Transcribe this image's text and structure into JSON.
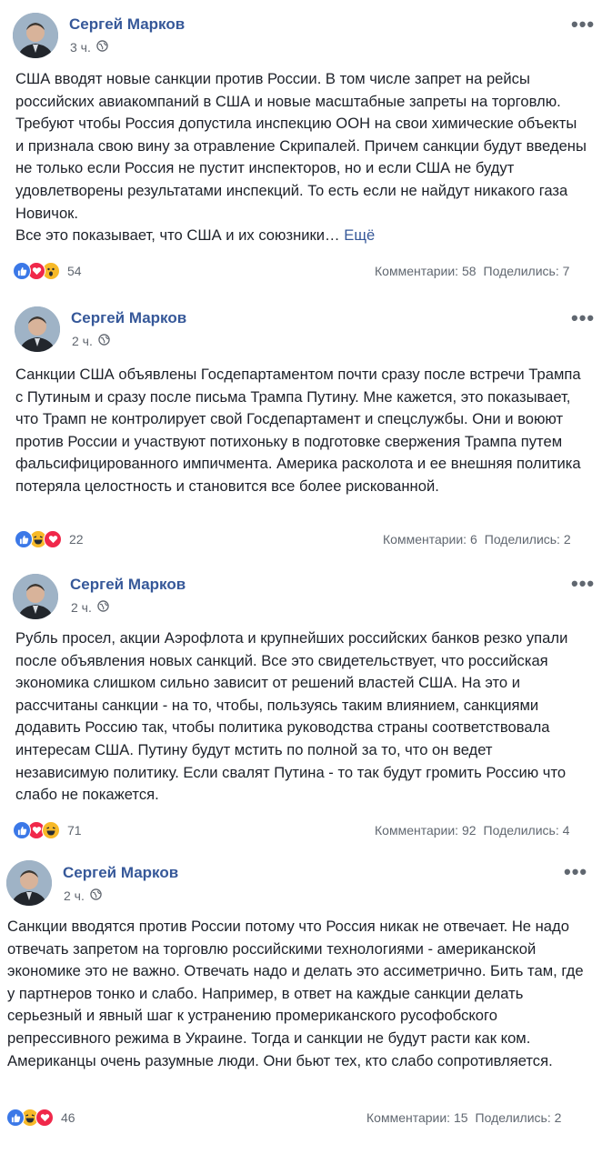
{
  "posts": [
    {
      "author": "Сергей Марков",
      "time": "3 ч.",
      "text": "США вводят новые санкции против России. В том числе запрет на рейсы российских авиакомпаний в США и новые масштабные запреты на торговлю. Требуют чтобы Россия допустила инспекцию ООН на свои химические объекты и признала свою вину за отравление Скрипалей. Причем санкции будут введены не только если Россия не пустит инспекторов, но и если США не будут удовлетворены результатами инспекций. То есть если не найдут никакого газа Новичок.\nВсе это показывает, что США и их союзники…",
      "see_more": "Ещё",
      "reactions": [
        "like-icon",
        "love-icon",
        "wow-icon"
      ],
      "reaction_count": "54",
      "comments": "Комментарии: 58",
      "shares": "Поделились: 7"
    },
    {
      "author": "Сергей Марков",
      "time": "2 ч.",
      "text": "Санкции США объявлены Госдепартаментом почти сразу после встречи Трампа с Путиным и сразу после письма Трампа Путину. Мне кажется, это показывает, что Трамп не контролирует свой Госдепартамент и спецслужбы. Они и воюют против России и участвуют потихоньку в подготовке свержения Трампа путем фальсифицированного импичмента. Америка расколота и ее внешняя политика потеряла целостность и становится все более рискованной.",
      "see_more": "",
      "reactions": [
        "like-icon",
        "haha-icon",
        "love-icon"
      ],
      "reaction_count": "22",
      "comments": "Комментарии: 6",
      "shares": "Поделились: 2"
    },
    {
      "author": "Сергей Марков",
      "time": "2 ч.",
      "text": "Рубль просел, акции Аэрофлота и крупнейших российских банков резко упали после объявления новых санкций. Все это свидетельствует, что российская экономика слишком сильно зависит от решений властей США. На это и рассчитаны санкции - на то, чтобы, пользуясь таким влиянием, санкциями додавить Россию так, чтобы политика руководства страны соответствовала интересам США. Путину будут мстить по полной за то, что он ведет независимую политику. Если свалят Путина - то так будут громить Россию что слабо не покажется.",
      "see_more": "",
      "reactions": [
        "like-icon",
        "love-icon",
        "haha-icon"
      ],
      "reaction_count": "71",
      "comments": "Комментарии: 92",
      "shares": "Поделились: 4"
    },
    {
      "author": "Сергей Марков",
      "time": "2 ч.",
      "text": "Санкции вводятся против России потому что Россия никак не отвечает. Не надо отвечать запретом на торговлю российскими технологиями - американской экономике это не важно. Отвечать надо и делать это ассиметрично. Бить там, где у партнеров тонко и слабо. Например, в ответ на каждые санкции делать серьезный и явный шаг к устранению промериканского русофобского репрессивного режима в Украине. Тогда и санкции не будут расти как ком. Американцы очень разумные люди. Они бьют тех, кто слабо сопротивляется.",
      "see_more": "",
      "reactions": [
        "like-icon",
        "haha-icon",
        "love-icon"
      ],
      "reaction_count": "46",
      "comments": "Комментарии: 15",
      "shares": "Поделились: 2"
    }
  ]
}
